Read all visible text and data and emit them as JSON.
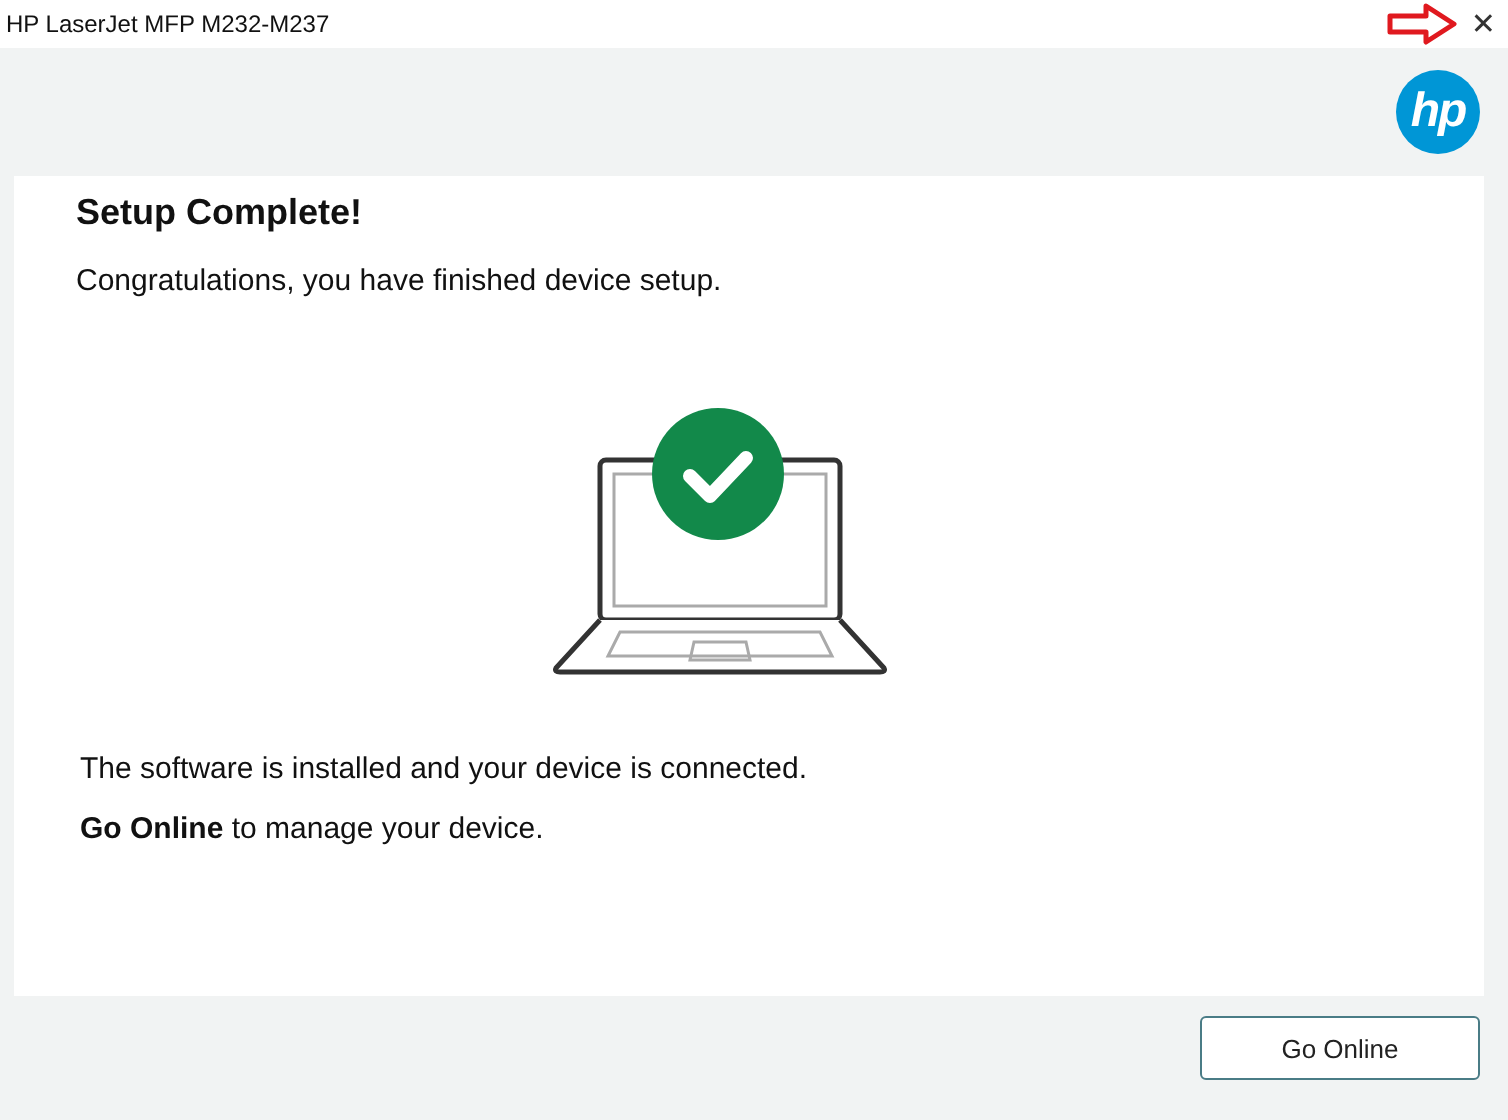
{
  "window": {
    "title": "HP LaserJet MFP M232-M237",
    "close": "✕"
  },
  "header": {
    "logo_text": "hp"
  },
  "content": {
    "heading": "Setup Complete!",
    "subtitle": "Congratulations, you have finished device setup.",
    "status": "The software is installed and your device is connected.",
    "hint": "**Go Online** to manage your device."
  },
  "buttons": [
    "Go Online"
  ]
}
